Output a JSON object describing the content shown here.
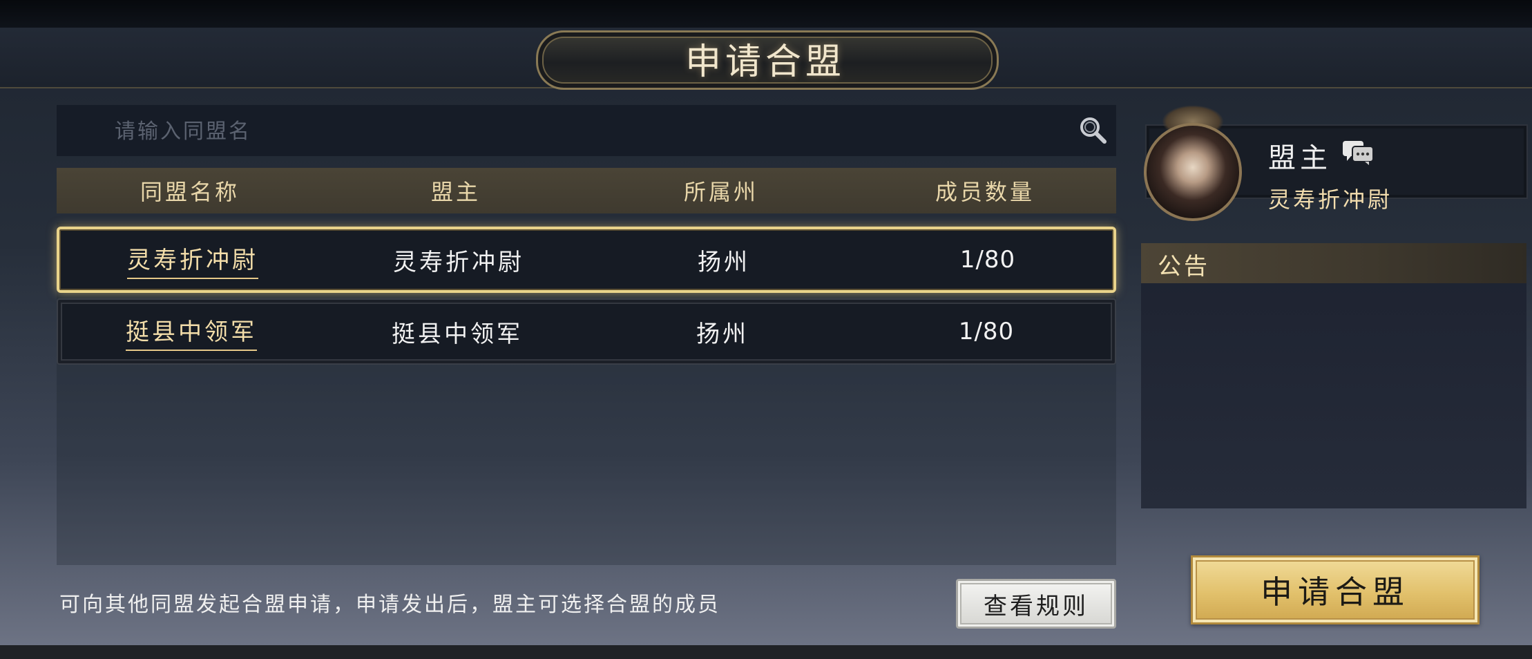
{
  "window": {
    "title": "申请合盟"
  },
  "search": {
    "placeholder": "请输入同盟名",
    "icon": "search-icon"
  },
  "table": {
    "columns": [
      "同盟名称",
      "盟主",
      "所属州",
      "成员数量"
    ],
    "rows": [
      {
        "name": "灵寿折冲尉",
        "leader": "灵寿折冲尉",
        "state": "扬州",
        "members": "1/80",
        "selected": true
      },
      {
        "name": "挺县中领军",
        "leader": "挺县中领军",
        "state": "扬州",
        "members": "1/80",
        "selected": false
      }
    ]
  },
  "leader_panel": {
    "label": "盟主",
    "name": "灵寿折冲尉",
    "chat_icon": "chat-icon"
  },
  "notice": {
    "title": "公告"
  },
  "footer": {
    "hint": "可向其他同盟发起合盟申请，申请发出后，盟主可选择合盟的成员",
    "rules_button": "查看规则",
    "apply_button": "申请合盟"
  },
  "colors": {
    "accent_gold": "#e9d38a",
    "button_gold": "#e2c16c",
    "header_brown": "#4a4436"
  }
}
